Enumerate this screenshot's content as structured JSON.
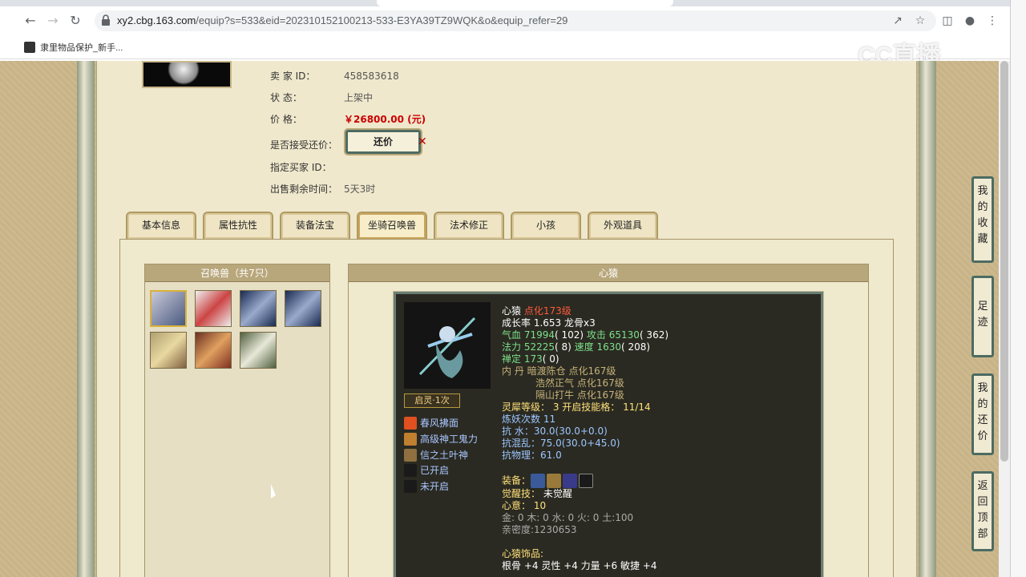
{
  "browser": {
    "url_host": "xy2.cbg.163.com",
    "url_path": "/equip?s=533&eid=202310152100213-533-E3YA39TZ9WQK&o&equip_refer=29",
    "bookmark_label": "隶里物品保护_新手..."
  },
  "watermark": "CC直播",
  "seller": {
    "id_label": "卖  家   ID：",
    "id_value": "458583618",
    "status_label": "状        态：",
    "status_value": "上架中",
    "price_label": "价        格：",
    "price_value": "￥26800.00 (元)",
    "accept_counter_label": "是否接受还价：",
    "counter_button": "还价",
    "designated_buyer_label": "指定买家 ID：",
    "time_left_label": "出售剩余时间：",
    "time_left_value": "5天3时"
  },
  "tabs": [
    {
      "label": "基本信息"
    },
    {
      "label": "属性抗性"
    },
    {
      "label": "装备法宝"
    },
    {
      "label": "坐骑召唤兽",
      "active": true
    },
    {
      "label": "法术修正"
    },
    {
      "label": "小孩"
    },
    {
      "label": "外观道具"
    }
  ],
  "pet_list": {
    "header": "召唤兽（共7只）",
    "count": 7
  },
  "detail": {
    "header": "心猿",
    "qiling": "启灵·1次",
    "skills": [
      {
        "label": "春风拂面",
        "icon": "fire-icon",
        "color": "#e05020"
      },
      {
        "label": "高级神工鬼力",
        "icon": "gear-icon",
        "color": "#c08030"
      },
      {
        "label": "信之土叶神",
        "icon": "leaf-icon",
        "color": "#907040"
      },
      {
        "label": "已开启",
        "icon": "slot-icon",
        "color": "#333"
      },
      {
        "label": "未开启",
        "icon": "slot-icon",
        "color": "#333"
      }
    ],
    "name": "心猿",
    "name_suffix": "点化173级",
    "growth": "成长率 1.653 龙骨x3",
    "hp_label": "气血 ",
    "hp": "71994",
    "hp_extra": "( 102)",
    "atk_label": " 攻击 ",
    "atk": "65130",
    "atk_extra": "( 362)",
    "mp_label": "法力 ",
    "mp": "52225",
    "mp_extra": "( 8)",
    "spd_label": " 速度 ",
    "spd": "1630",
    "spd_extra": "( 208)",
    "zen_label": "禅定 ",
    "zen": "173",
    "zen_extra": "( 0)",
    "neidan_label": "内    丹",
    "neidan": [
      "暗渡陈仓 点化167级",
      "浩然正气 点化167级",
      "隔山打牛 点化167级"
    ],
    "lingxi": "灵犀等级：  3 开启技能格：  11/14",
    "lianyao": "炼妖次数 11",
    "resist_water": "抗    水：30.0(30.0+0.0)",
    "resist_chaos": "抗混乱：75.0(30.0+45.0)",
    "resist_phys": "抗物理：61.0",
    "equip_label": "装备：",
    "awaken_label": "觉醒技：",
    "awaken_value": "未觉醒",
    "xinyi": "心意：  10",
    "elements": "金: 0 木: 0 水: 0 火: 0 土:100",
    "intimacy": "亲密度:1230653",
    "ornament_label": "心猿饰品:",
    "ornament_stats": "根骨 +4 灵性 +4 力量 +6 敏捷 +4"
  },
  "side_buttons": [
    {
      "label": "我的收藏"
    },
    {
      "label": "足迹"
    },
    {
      "label": "我的还价"
    },
    {
      "label": "返回顶部"
    }
  ],
  "colors": {
    "price": "#cc0000",
    "panel_bg": "#efe8cc",
    "card_bg": "#2a2a22"
  }
}
